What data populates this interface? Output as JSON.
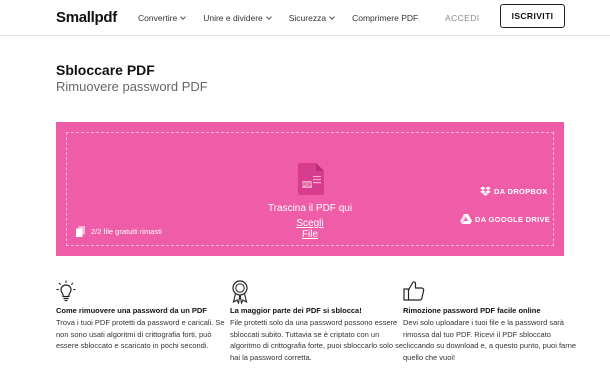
{
  "header": {
    "logo": "Smallpdf",
    "nav": [
      {
        "label": "Convertire",
        "has_dropdown": true
      },
      {
        "label": "Unire e dividere",
        "has_dropdown": true
      },
      {
        "label": "Sicurezza",
        "has_dropdown": true
      },
      {
        "label": "Comprimere PDF",
        "has_dropdown": false
      }
    ],
    "login_label": "ACCEDI",
    "signup_label": "ISCRIVITI"
  },
  "page": {
    "title": "Sbloccare PDF",
    "subtitle": "Rimuovere password PDF"
  },
  "dropzone": {
    "background_color": "#ef5da8",
    "file_icon_label": "PDF",
    "prompt": "Trascina il PDF qui",
    "choose_file_label": "Scegli File",
    "credits_text": "2/2 file gratuiti rimasti",
    "dropbox_label": "DA DROPBOX",
    "gdrive_label": "DA GOOGLE DRIVE"
  },
  "features": [
    {
      "icon": "lightbulb-icon",
      "title": "Come rimuovere una password da un PDF",
      "body": "Trova i tuoi PDF protetti da password e caricali. Se non sono usati algoritmi di crittografia forti, può essere sbloccato e scaricato in pochi secondi."
    },
    {
      "icon": "award-ribbon-icon",
      "title": "La maggior parte dei PDF si sblocca!",
      "body": "File protetti solo da una password possono essere sbloccati subito. Tuttavia se è criptato con un algoritmo di crittografia forte, puoi sbloccarlo solo se hai la password corretta."
    },
    {
      "icon": "thumbs-up-icon",
      "title": "Rimozione password PDF facile online",
      "body": "Devi solo uploadare i tuoi file e la password sarà rimossa dal tuo PDF. Ricevi il PDF sbloccato cliccando su download e, a questo punto, puoi farne quello che vuoi!"
    }
  ]
}
